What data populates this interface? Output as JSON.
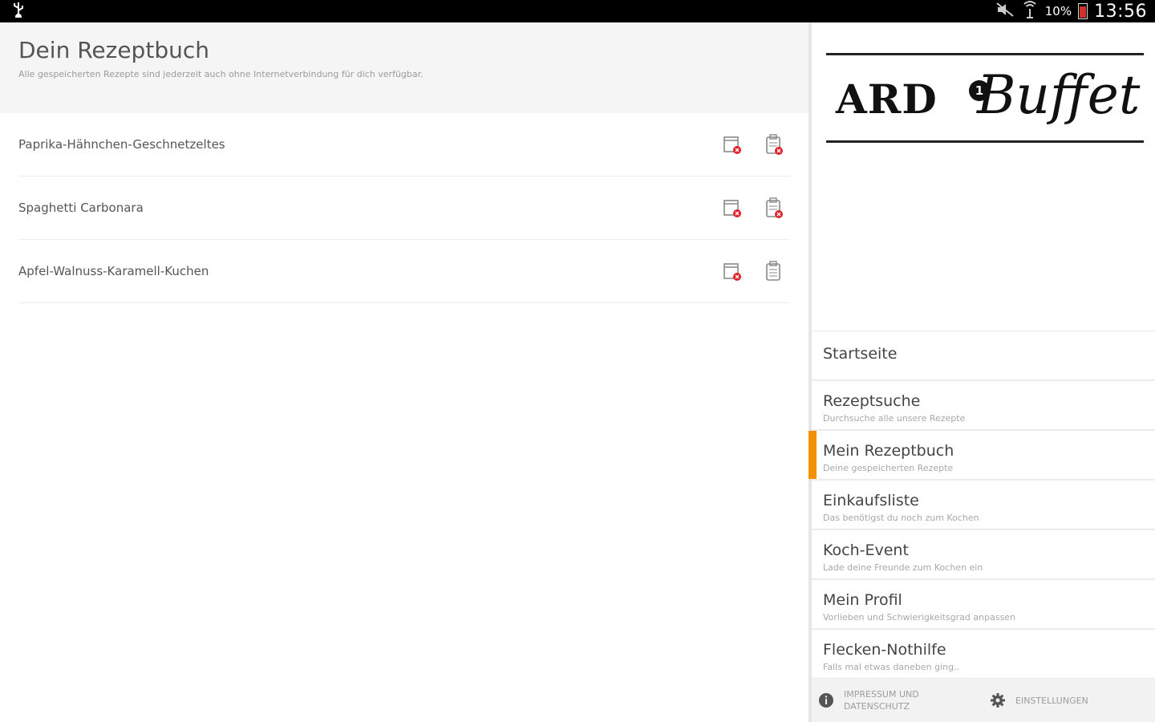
{
  "status_bar": {
    "left_icon": "usb-icon",
    "right_icons": [
      "mute-icon",
      "signal-icon"
    ],
    "battery": "10%",
    "time": "13:56"
  },
  "header": {
    "title": "Dein Rezeptbuch",
    "subtitle": "Alle gespeicherten Rezepte sind jederzeit auch ohne Internetverbindung für dich verfügbar."
  },
  "recipes": [
    {
      "name": "Paprika-Hähnchen-Geschnetzeltes"
    },
    {
      "name": "Spaghetti Carbonara"
    },
    {
      "name": "Apfel-Walnuss-Karamell-Kuchen"
    }
  ],
  "drawer": {
    "logo": {
      "ard": "ARD",
      "one": "1",
      "buffet": "Buffet"
    },
    "nav": [
      {
        "title": "Startseite",
        "sub": ""
      },
      {
        "title": "Rezeptsuche",
        "sub": "Durchsuche alle unsere Rezepte"
      },
      {
        "title": "Mein Rezeptbuch",
        "sub": "Deine gespeicherten Rezepte",
        "active": true
      },
      {
        "title": "Einkaufsliste",
        "sub": "Das benötigst du noch zum Kochen"
      },
      {
        "title": "Koch-Event",
        "sub": "Lade deine Freunde zum Kochen ein"
      },
      {
        "title": "Mein Profil",
        "sub": "Vorlieben und Schwierigkeitsgrad anpassen"
      },
      {
        "title": "Flecken-Nothilfe",
        "sub": "Falls mal etwas daneben ging.."
      }
    ],
    "footer": {
      "impressum_line1": "IMPRESSUM UND",
      "impressum_line2": "DATENSCHUTZ",
      "settings": "EINSTELLUNGEN"
    }
  },
  "colors": {
    "accent": "#f39000",
    "delete_red": "#e0202a"
  }
}
